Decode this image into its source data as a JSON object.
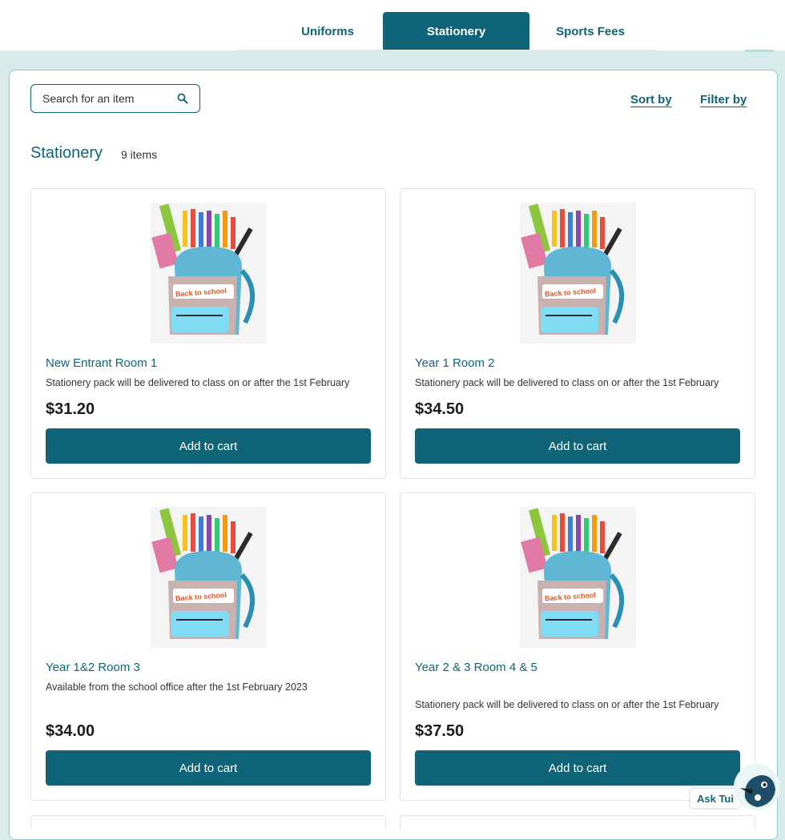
{
  "tabs": [
    {
      "label": "Uniforms",
      "active": false
    },
    {
      "label": "Stationery",
      "active": true
    },
    {
      "label": "Sports Fees",
      "active": false
    }
  ],
  "search": {
    "placeholder": "Search for an item"
  },
  "toolbar": {
    "sort_label": "Sort by",
    "filter_label": "Filter by"
  },
  "section": {
    "title": "Stationery",
    "count": "9 items"
  },
  "products": [
    {
      "name": "New Entrant Room 1",
      "description": "Stationery pack will be delivered to class on or after the 1st February",
      "price": "$31.20",
      "button": "Add to cart"
    },
    {
      "name": "Year 1 Room 2",
      "description": "Stationery pack will be delivered to class on or after the 1st February",
      "price": "$34.50",
      "button": "Add to cart"
    },
    {
      "name": "Year 1&2 Room 3",
      "description": "Available from the school office after the 1st February 2023",
      "price": "$34.00",
      "button": "Add to cart"
    },
    {
      "name": "Year 2 & 3 Room 4 & 5",
      "description": "Stationery pack will be delivered to class on or after the 1st February",
      "price": "$37.50",
      "button": "Add to cart"
    }
  ],
  "image_text": "Back to school",
  "chat": {
    "label": "Ask Tui"
  },
  "colors": {
    "brand": "#0f6577",
    "background": "#d7ebeb",
    "panel_border": "#8fcaca"
  }
}
